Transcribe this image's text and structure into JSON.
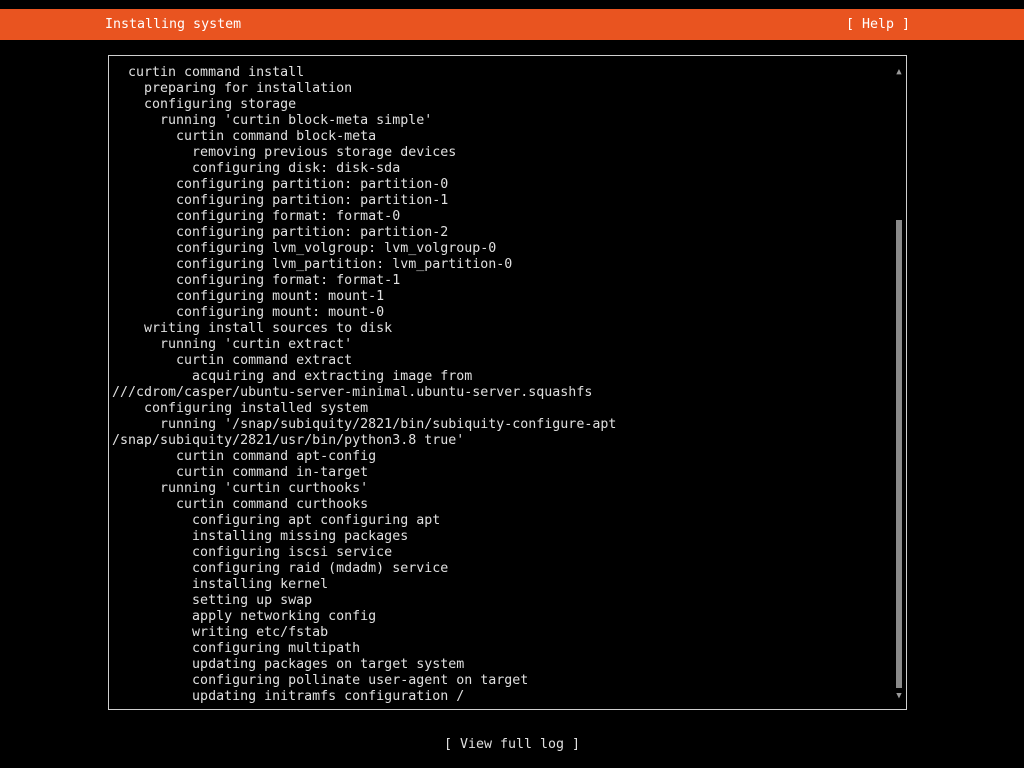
{
  "header": {
    "title": "Installing system",
    "help_label": "[ Help ]"
  },
  "log": {
    "lines": [
      "  curtin command install",
      "    preparing for installation",
      "    configuring storage",
      "      running 'curtin block-meta simple'",
      "        curtin command block-meta",
      "          removing previous storage devices",
      "          configuring disk: disk-sda",
      "        configuring partition: partition-0",
      "        configuring partition: partition-1",
      "        configuring format: format-0",
      "        configuring partition: partition-2",
      "        configuring lvm_volgroup: lvm_volgroup-0",
      "        configuring lvm_partition: lvm_partition-0",
      "        configuring format: format-1",
      "        configuring mount: mount-1",
      "        configuring mount: mount-0",
      "    writing install sources to disk",
      "      running 'curtin extract'",
      "        curtin command extract",
      "          acquiring and extracting image from",
      "///cdrom/casper/ubuntu-server-minimal.ubuntu-server.squashfs",
      "    configuring installed system",
      "      running '/snap/subiquity/2821/bin/subiquity-configure-apt",
      "/snap/subiquity/2821/usr/bin/python3.8 true'",
      "        curtin command apt-config",
      "        curtin command in-target",
      "      running 'curtin curthooks'",
      "        curtin command curthooks",
      "          configuring apt configuring apt",
      "          installing missing packages",
      "          configuring iscsi service",
      "          configuring raid (mdadm) service",
      "          installing kernel",
      "          setting up swap",
      "          apply networking config",
      "          writing etc/fstab",
      "          configuring multipath",
      "          updating packages on target system",
      "          configuring pollinate user-agent on target",
      "          updating initramfs configuration /"
    ],
    "scrollbar": {
      "up_icon": "▲",
      "down_icon": "▼",
      "thumb_start_fraction": 0.23,
      "thumb_size_fraction": 0.77
    }
  },
  "footer": {
    "view_log_label": "[ View full log ]"
  },
  "colors": {
    "accent": "#e95420",
    "background": "#000000",
    "text": "#e0e0e0"
  }
}
